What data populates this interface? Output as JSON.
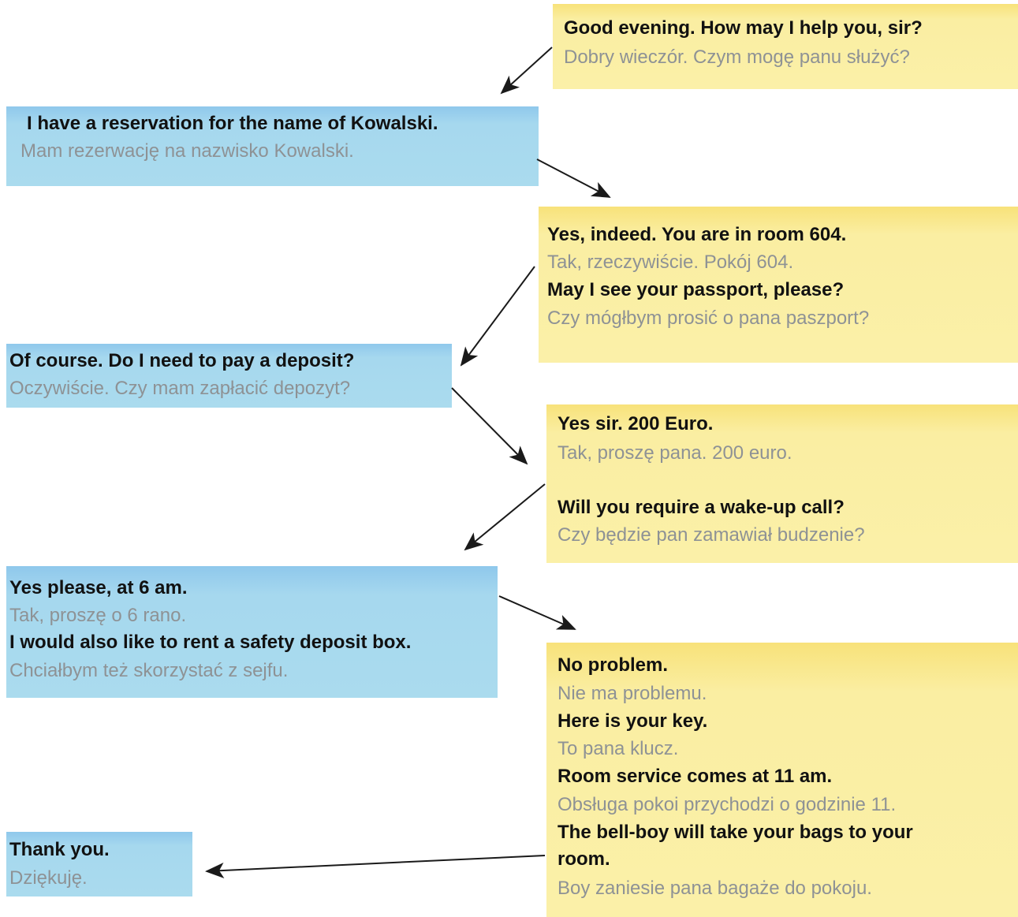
{
  "colors": {
    "staff_box": "#fbf0a8",
    "guest_box": "#aadbee",
    "english_text": "#111111",
    "polish_text": "#8e9295",
    "arrow": "#1a1a1a"
  },
  "dialogue": [
    {
      "speaker": "receptionist",
      "lines": [
        {
          "lang": "en",
          "text": "Good evening. How may I help you, sir?"
        },
        {
          "lang": "pl",
          "text": "Dobry wieczór. Czym mogę panu służyć?"
        }
      ]
    },
    {
      "speaker": "guest",
      "lines": [
        {
          "lang": "en",
          "text": "I have a reservation for the name of Kowalski."
        },
        {
          "lang": "pl",
          "text": "Mam rezerwację na nazwisko Kowalski."
        }
      ]
    },
    {
      "speaker": "receptionist",
      "lines": [
        {
          "lang": "en",
          "text": "Yes, indeed. You are in room 604."
        },
        {
          "lang": "pl",
          "text": "Tak, rzeczywiście. Pokój 604."
        },
        {
          "lang": "en",
          "text": "May I see your passport, please?"
        },
        {
          "lang": "pl",
          "text": "Czy mógłbym prosić o pana paszport?"
        }
      ]
    },
    {
      "speaker": "guest",
      "lines": [
        {
          "lang": "en",
          "text": "Of course. Do I need to pay  a deposit?"
        },
        {
          "lang": "pl",
          "text": "Oczywiście. Czy mam zapłacić depozyt?"
        }
      ]
    },
    {
      "speaker": "receptionist",
      "lines": [
        {
          "lang": "en",
          "text": "Yes sir. 200 Euro."
        },
        {
          "lang": "pl",
          "text": "Tak, proszę pana. 200 euro."
        },
        {
          "lang": "en",
          "text": "Will you require a wake-up call?"
        },
        {
          "lang": "pl",
          "text": "Czy będzie pan zamawiał budzenie?"
        }
      ]
    },
    {
      "speaker": "guest",
      "lines": [
        {
          "lang": "en",
          "text": "Yes please, at 6 am."
        },
        {
          "lang": "pl",
          "text": "Tak, proszę o 6 rano."
        },
        {
          "lang": "en",
          "text": "I would also like to rent a safety deposit box."
        },
        {
          "lang": "pl",
          "text": "Chciałbym też skorzystać z sejfu."
        }
      ]
    },
    {
      "speaker": "receptionist",
      "lines": [
        {
          "lang": "en",
          "text": "No problem."
        },
        {
          "lang": "pl",
          "text": "Nie ma problemu."
        },
        {
          "lang": "en",
          "text": "Here is your key."
        },
        {
          "lang": "pl",
          "text": "To pana klucz."
        },
        {
          "lang": "en",
          "text": "Room service comes at 11 am."
        },
        {
          "lang": "pl",
          "text": "Obsługa pokoi przychodzi o godzinie 11."
        },
        {
          "lang": "en",
          "text": "The bell-boy will take your bags to your"
        },
        {
          "lang": "en",
          "text": "room."
        },
        {
          "lang": "pl",
          "text": "Boy zaniesie pana bagaże do pokoju."
        }
      ]
    },
    {
      "speaker": "guest",
      "lines": [
        {
          "lang": "en",
          "text": "Thank you."
        },
        {
          "lang": "pl",
          "text": "Dziękuję."
        }
      ]
    }
  ]
}
